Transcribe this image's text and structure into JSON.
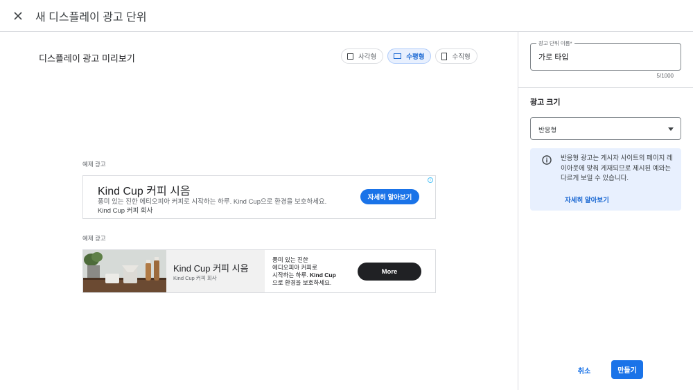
{
  "header": {
    "title": "새 디스플레이 광고 단위",
    "close_icon": "close-icon"
  },
  "preview": {
    "title": "디스플레이 광고 미리보기",
    "layout_options": [
      {
        "label": "사각형",
        "icon": "square-icon",
        "selected": false
      },
      {
        "label": "수평형",
        "icon": "horizontal-rect-icon",
        "selected": true
      },
      {
        "label": "수직형",
        "icon": "vertical-rect-icon",
        "selected": false
      }
    ],
    "ads": [
      {
        "label": "예제 광고",
        "headline": "Kind Cup 커피 시음",
        "description": "풍미 있는 진한 에티오피아 커피로 시작하는 하루. Kind Cup으로 환경을 보호하세요.",
        "advertiser": "Kind Cup 커피 회사",
        "cta": "자세히 알아보기",
        "adchoices_icon": "info-icon"
      },
      {
        "label": "예제 광고",
        "headline": "Kind Cup 커피 시음",
        "advertiser": "Kind Cup 커피 회사",
        "description_lines": [
          "풍미 있는 진한",
          "에디오피아 커피로",
          "시작하는 하루.",
          "Kind Cup",
          "으로 환경을 보호하세요."
        ],
        "cta": "More",
        "image": "coffee-product-photo"
      }
    ]
  },
  "settings": {
    "name_field": {
      "label": "광고 단위 이름*",
      "value": "가로 타입",
      "counter": "5/1000"
    },
    "size_section_title": "광고 크기",
    "size_select": {
      "value": "반응형"
    },
    "notice": {
      "text": "반응형 광고는 게시자 사이트의 페이지 레이아웃에 맞춰 게재되므로 제시된 예와는 다르게 보일 수 있습니다.",
      "link": "자세히 알아보기",
      "icon": "info-icon"
    },
    "actions": {
      "cancel": "취소",
      "create": "만들기"
    }
  },
  "colors": {
    "accent": "#1a73e8",
    "notice_bg": "#e8f0fe",
    "dark_button": "#202124"
  }
}
